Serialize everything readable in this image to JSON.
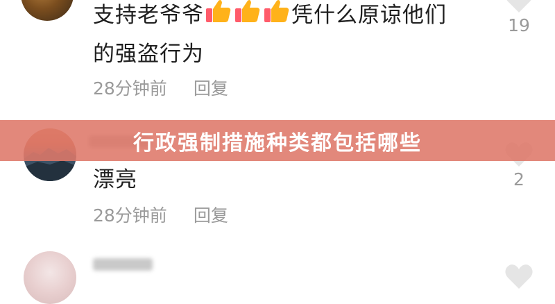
{
  "comments": [
    {
      "text_before": "支持老爷爷",
      "emoji": "thumbs-up-emoji",
      "emoji_count": 3,
      "text_after": "凭什么原谅他们",
      "text_line2": "的强盗行为",
      "time": "28分钟前",
      "reply_label": "回复",
      "like_count": "19"
    },
    {
      "text": "漂亮",
      "time": "28分钟前",
      "reply_label": "回复",
      "like_count": "2"
    },
    {
      "text": ""
    }
  ],
  "banner": {
    "title": "行政强制措施种类都包括哪些",
    "color": "#de7869"
  },
  "colors": {
    "text": "#1f1f1f",
    "meta": "#9a9a9a",
    "heart": "#e5e5e5",
    "thumbs": "#ffb21a",
    "thumbs_cuff": "#ff5b6a"
  }
}
